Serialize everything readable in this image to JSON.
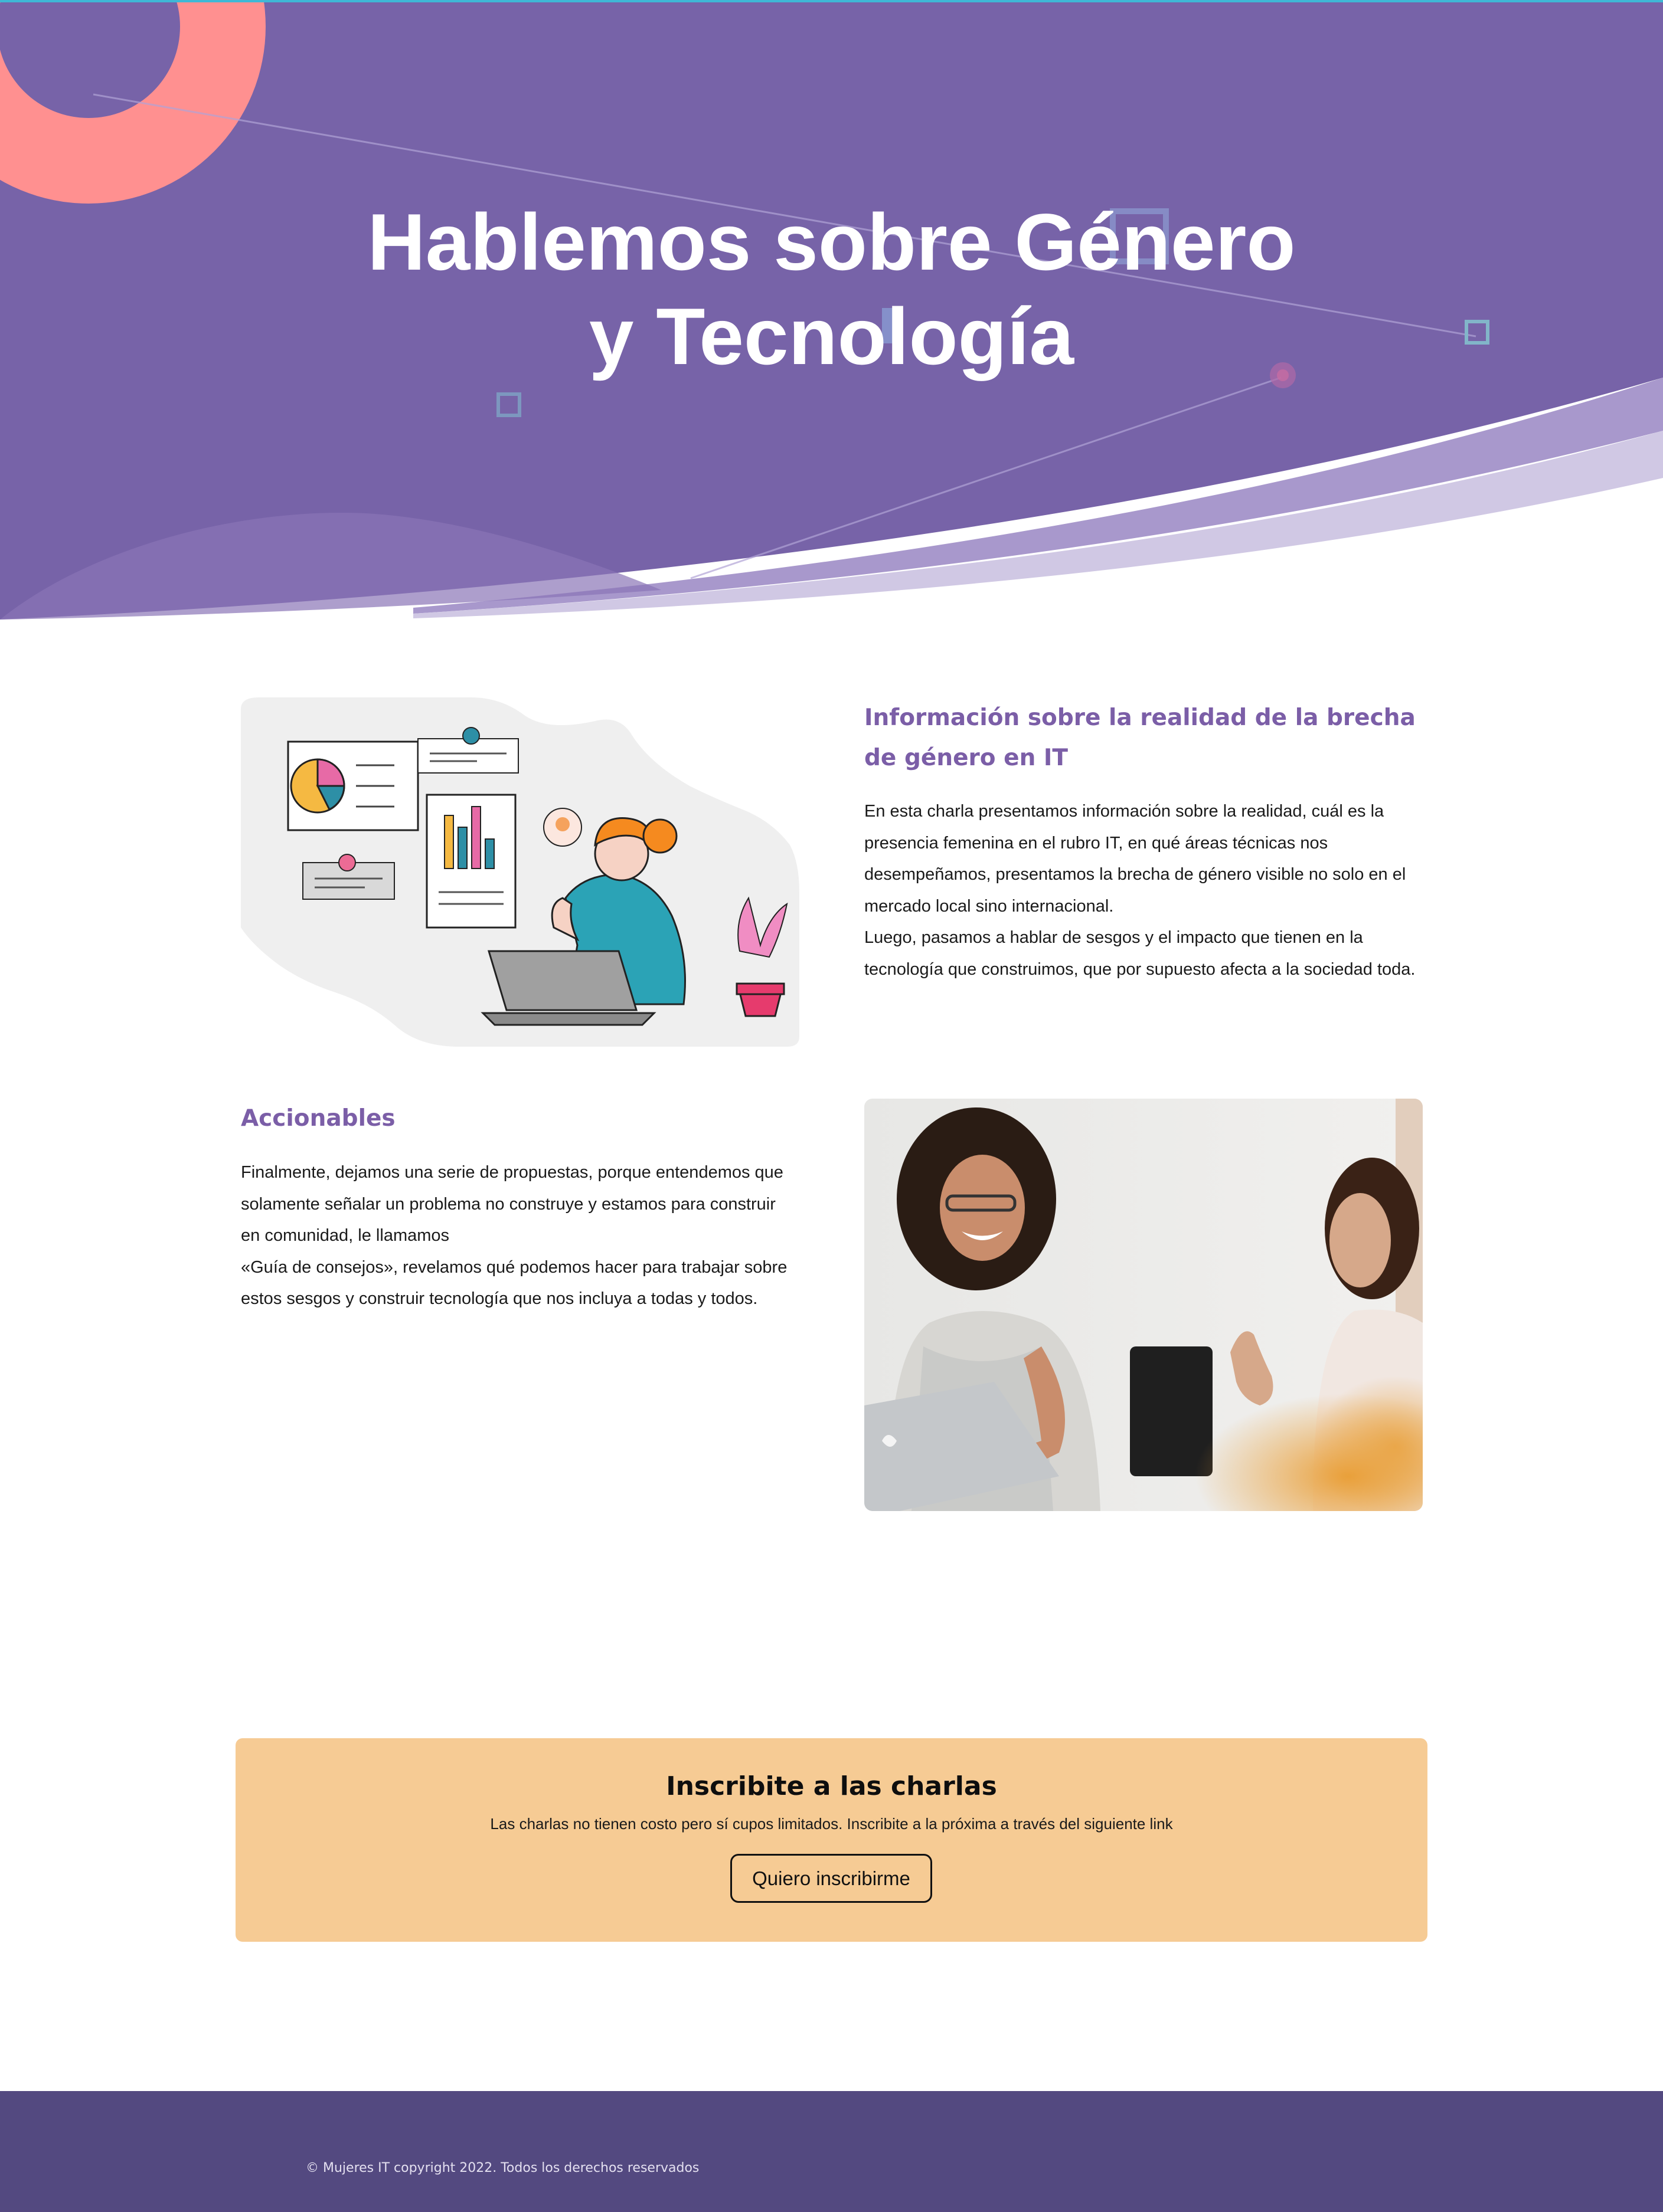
{
  "colors": {
    "hero_purple": "#7763a8",
    "accent_coral": "#ff9090",
    "heading_purple": "#7b5ea7",
    "cta_background": "#f6cb94",
    "footer_background": "#534980",
    "top_line": "#3fb8d6"
  },
  "hero": {
    "title_line_1": "Hablemos sobre Género",
    "title_line_2": "y Tecnología"
  },
  "section_info": {
    "heading": "Información sobre la realidad de la brecha de género en IT",
    "paragraph_1": "En esta charla presentamos información sobre la realidad, cuál es la presencia femenina en el rubro IT, en qué áreas técnicas nos desempeñamos, presentamos la brecha de género visible no solo en el mercado local sino internacional.",
    "paragraph_2": "Luego, pasamos a hablar de sesgos y el impacto que tienen en la tecnología que construimos, que por supuesto afecta a la sociedad toda.",
    "illustration": "woman-with-charts-illustration"
  },
  "section_actions": {
    "heading": "Accionables",
    "paragraph_1": "Finalmente, dejamos una serie de propuestas, porque entendemos que solamente señalar un problema no construye y estamos para construir en comunidad, le llamamos",
    "paragraph_2": "«Guía de consejos», revelamos qué podemos hacer para trabajar sobre estos sesgos y construir tecnología que nos incluya a todas y todos.",
    "photo": "women-laughing-at-meeting-photo"
  },
  "cta": {
    "title": "Inscribite a las charlas",
    "subtitle": "Las charlas no tienen costo pero sí cupos limitados. Inscribite a la próxima a través del siguiente link",
    "button_label": "Quiero inscribirme"
  },
  "footer": {
    "copyright": "© Mujeres IT copyright 2022. Todos los derechos reservados"
  }
}
